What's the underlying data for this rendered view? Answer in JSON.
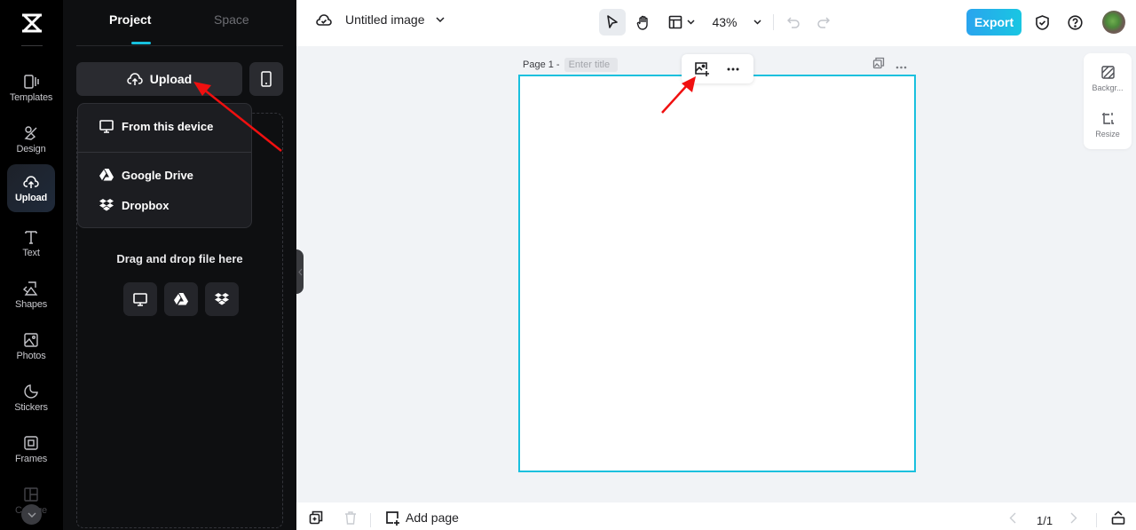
{
  "rail": {
    "items": [
      {
        "label": "Templates",
        "icon": "templates-icon"
      },
      {
        "label": "Design",
        "icon": "design-icon"
      },
      {
        "label": "Upload",
        "icon": "upload-cloud-icon",
        "active": true
      },
      {
        "label": "Text",
        "icon": "text-icon"
      },
      {
        "label": "Shapes",
        "icon": "shapes-icon"
      },
      {
        "label": "Photos",
        "icon": "photos-icon"
      },
      {
        "label": "Stickers",
        "icon": "stickers-icon"
      },
      {
        "label": "Frames",
        "icon": "frames-icon"
      },
      {
        "label": "Collage",
        "icon": "collage-icon"
      }
    ]
  },
  "panel": {
    "tabs": [
      {
        "label": "Project",
        "active": true
      },
      {
        "label": "Space",
        "active": false
      }
    ],
    "upload_label": "Upload",
    "menu": {
      "items": [
        {
          "label": "From this device",
          "icon": "monitor-icon"
        },
        {
          "label": "Google Drive",
          "icon": "google-drive-icon"
        },
        {
          "label": "Dropbox",
          "icon": "dropbox-icon"
        }
      ]
    },
    "dropzone_text": "Drag and drop file here"
  },
  "topbar": {
    "doc_title": "Untitled image",
    "zoom": "43%",
    "export_label": "Export"
  },
  "canvas": {
    "page_label": "Page 1 -",
    "title_placeholder": "Enter title"
  },
  "right_tools": [
    {
      "label": "Backgr...",
      "icon": "background-icon"
    },
    {
      "label": "Resize",
      "icon": "resize-icon"
    }
  ],
  "bottombar": {
    "add_page_label": "Add page",
    "page_count": "1/1"
  },
  "colors": {
    "accent": "#17c0de",
    "export_start": "#2aa4ee",
    "export_end": "#19c6e2",
    "annotation_arrow": "#f01010"
  }
}
